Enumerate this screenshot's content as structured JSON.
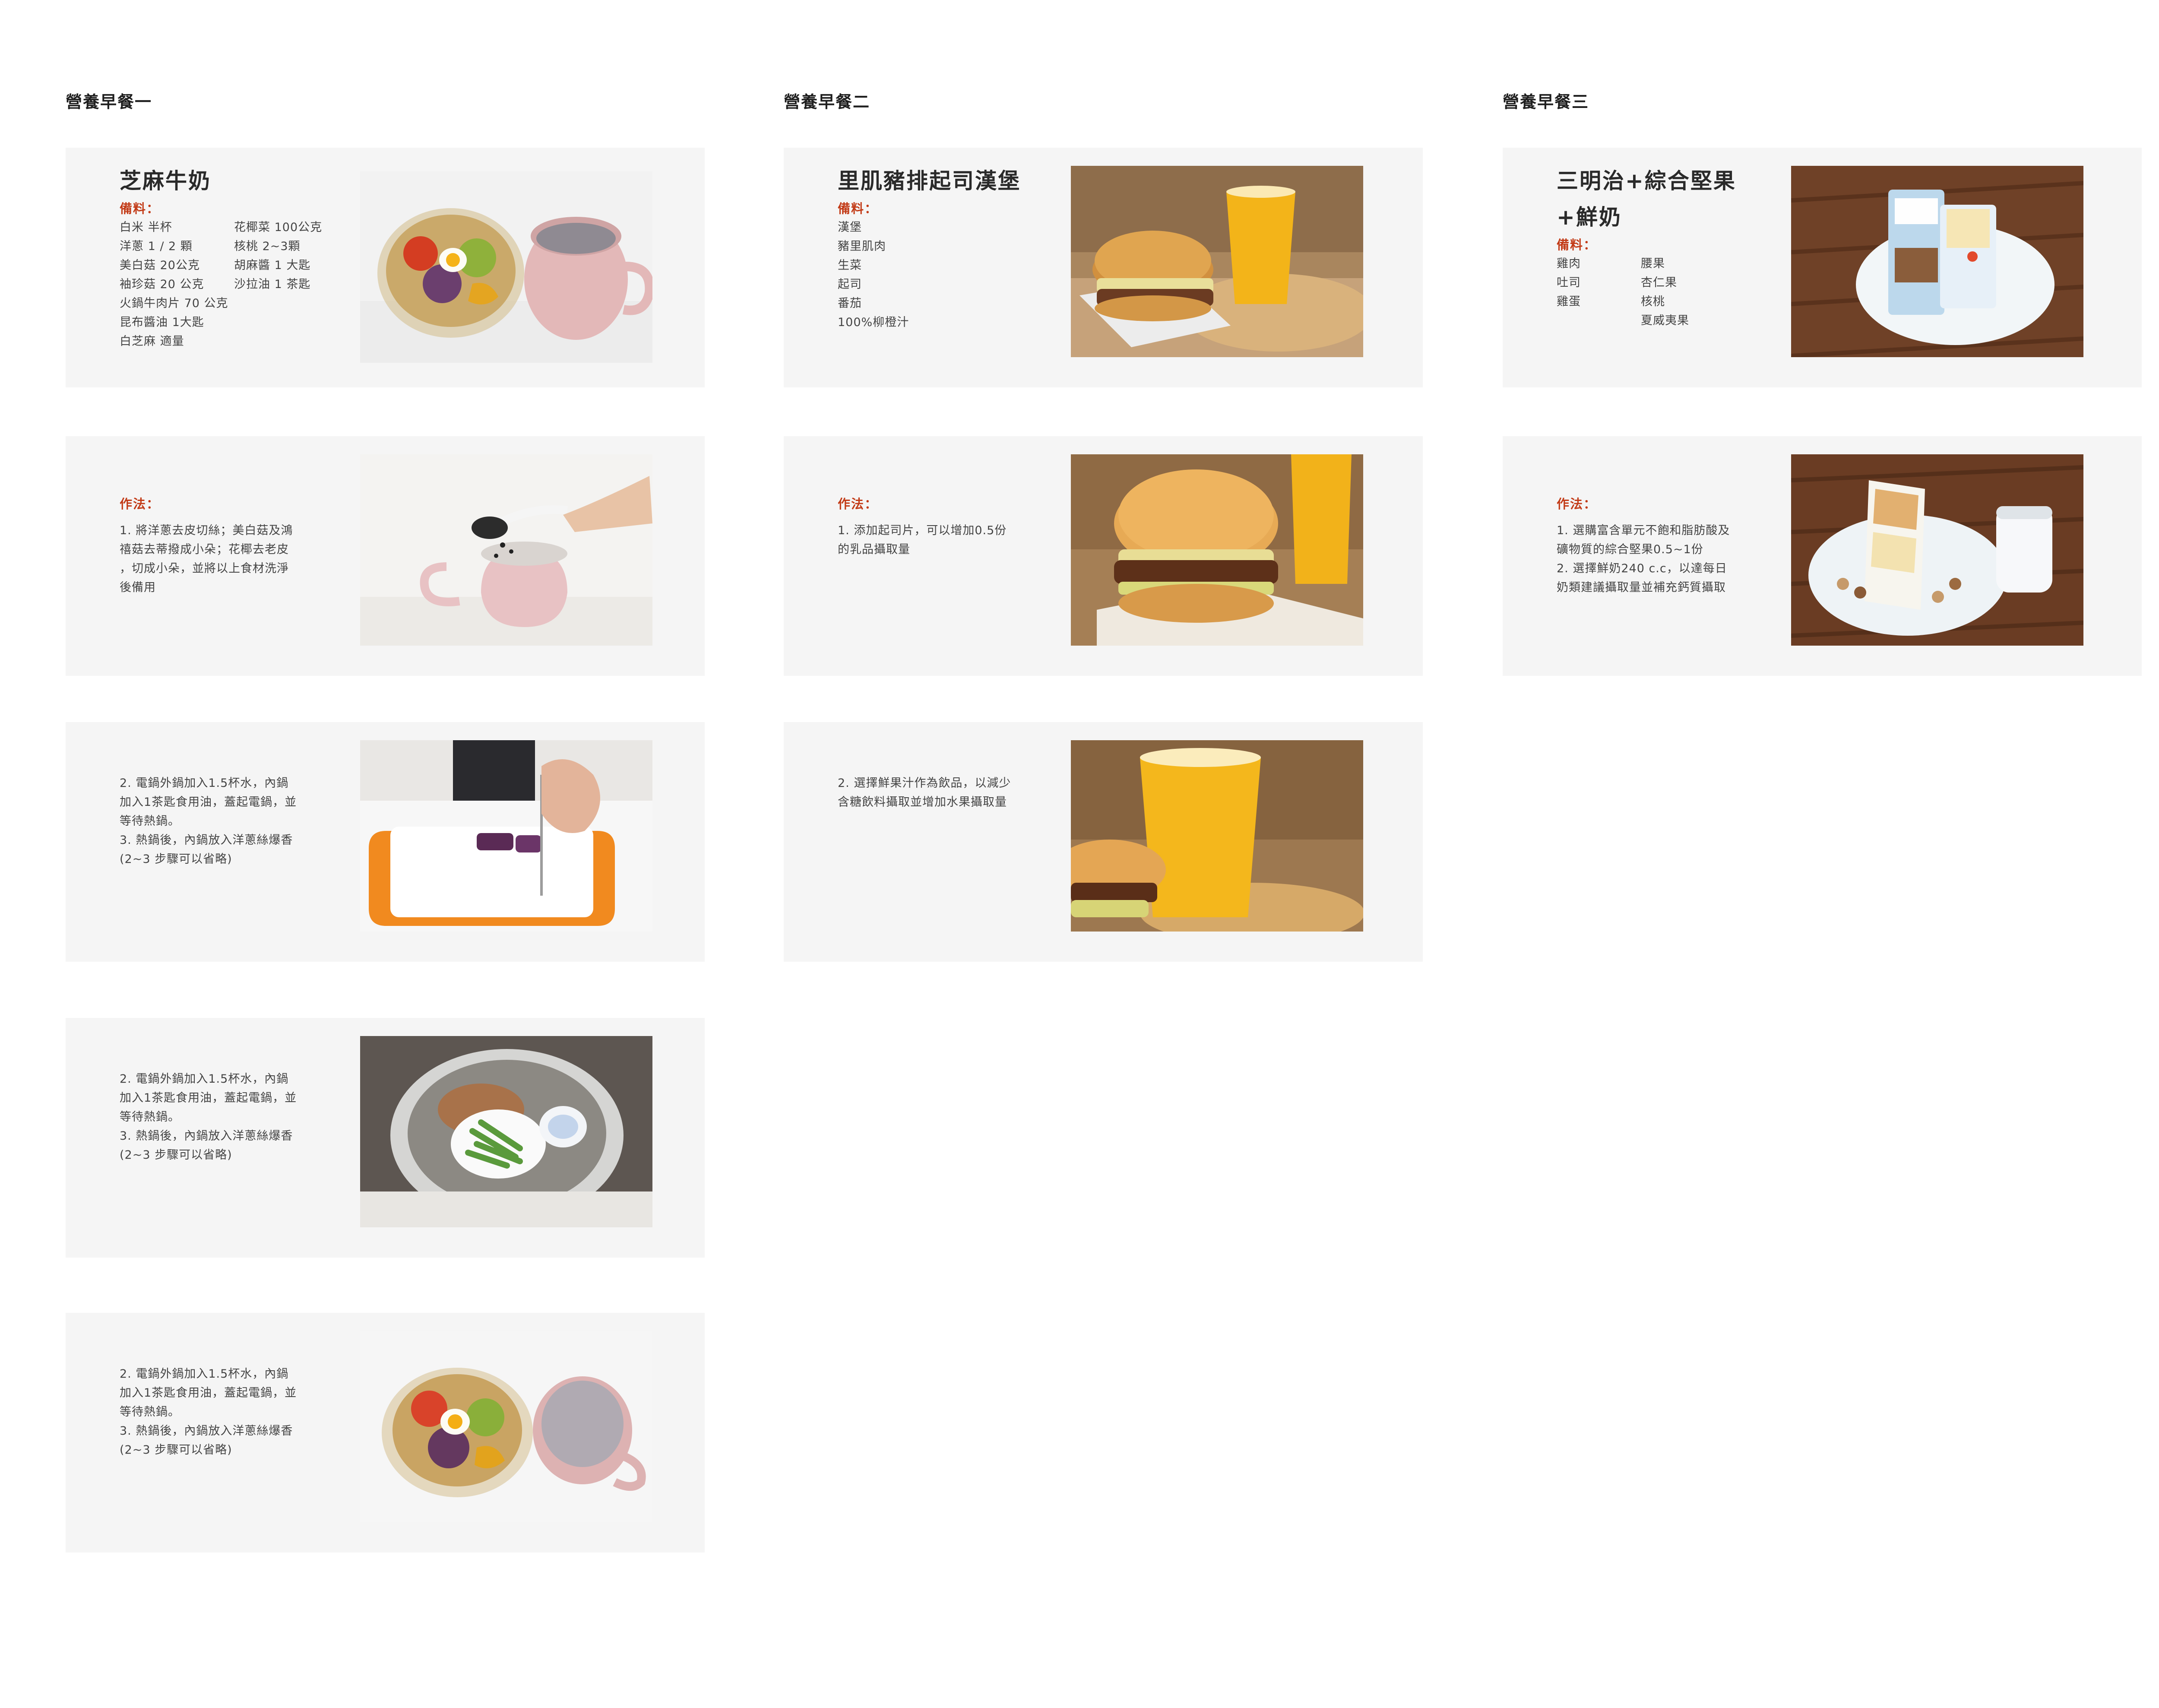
{
  "columns": [
    {
      "title": "營養早餐一",
      "cards": [
        {
          "type": "ingredients",
          "dish": "芝麻牛奶",
          "ingredients_label": "備料：",
          "ing_col1": "白米 半杯\n洋蔥 1 / 2 顆\n美白菇 20公克\n袖珍菇 20 公克\n火鍋牛肉片 70 公克\n昆布醬油 1大匙\n白芝麻 適量",
          "ing_col2": "花椰菜 100公克\n核桃 2~3顆\n胡麻醬 1 大匙\n沙拉油 1 茶匙"
        },
        {
          "type": "method",
          "method_label": "作法：",
          "text": "1. 將洋蔥去皮切絲；美白菇及鴻\n禧菇去蒂撥成小朵；花椰去老皮\n，切成小朵，並將以上食材洗淨\n後備用"
        },
        {
          "type": "step",
          "text": "2. 電鍋外鍋加入1.5杯水，內鍋\n加入1茶匙食用油，蓋起電鍋，並\n等待熱鍋。\n3. 熱鍋後，內鍋放入洋蔥絲爆香\n(2~3 步驟可以省略)"
        },
        {
          "type": "step",
          "text": "2. 電鍋外鍋加入1.5杯水，內鍋\n加入1茶匙食用油，蓋起電鍋，並\n等待熱鍋。\n3. 熱鍋後，內鍋放入洋蔥絲爆香\n(2~3 步驟可以省略)"
        },
        {
          "type": "step",
          "text": "2. 電鍋外鍋加入1.5杯水，內鍋\n加入1茶匙食用油，蓋起電鍋，並\n等待熱鍋。\n3. 熱鍋後，內鍋放入洋蔥絲爆香\n(2~3 步驟可以省略)"
        }
      ]
    },
    {
      "title": "營養早餐二",
      "cards": [
        {
          "type": "ingredients",
          "dish": "里肌豬排起司漢堡",
          "ingredients_label": "備料：",
          "ing_col1": "漢堡\n豬里肌肉\n生菜\n起司\n番茄\n100%柳橙汁",
          "ing_col2": ""
        },
        {
          "type": "method",
          "method_label": "作法：",
          "text": "1. 添加起司片，可以增加0.5份\n的乳品攝取量"
        },
        {
          "type": "step",
          "text": "2. 選擇鮮果汁作為飲品，以減少\n含糖飲料攝取並增加水果攝取量"
        }
      ]
    },
    {
      "title": "營養早餐三",
      "cards": [
        {
          "type": "ingredients",
          "dish": "三明治+綜合堅果\n+鮮奶",
          "ingredients_label": "備料：",
          "ing_col1": "雞肉\n吐司\n雞蛋",
          "ing_col2": "腰果\n杏仁果\n核桃\n夏威夷果"
        },
        {
          "type": "method",
          "method_label": "作法：",
          "text": "1. 選購富含單元不飽和脂肪酸及\n礦物質的綜合堅果0.5~1份\n2. 選擇鮮奶240 c.c，以達每日\n奶類建議攝取量並補充鈣質攝取"
        }
      ]
    }
  ],
  "colors": {
    "card_bg": "#f5f5f5",
    "accent_label": "#c23a16",
    "title": "#1e1e1e"
  },
  "photos": [
    "bowl-with-vegetables-and-sesame-milk-mug",
    "adding-sesame-to-milk-mug",
    "cutting-sweet-potato-on-board",
    "vegetables-in-rice-cooker",
    "bowl-with-vegetables-and-sesame-milk-mug",
    "pork-cheese-burger-with-orange-juice",
    "pork-cheese-burger-closeup",
    "orange-juice-with-burger",
    "sandwich-and-nut-packs-on-plate",
    "sandwich-nuts-and-milk-glass"
  ]
}
